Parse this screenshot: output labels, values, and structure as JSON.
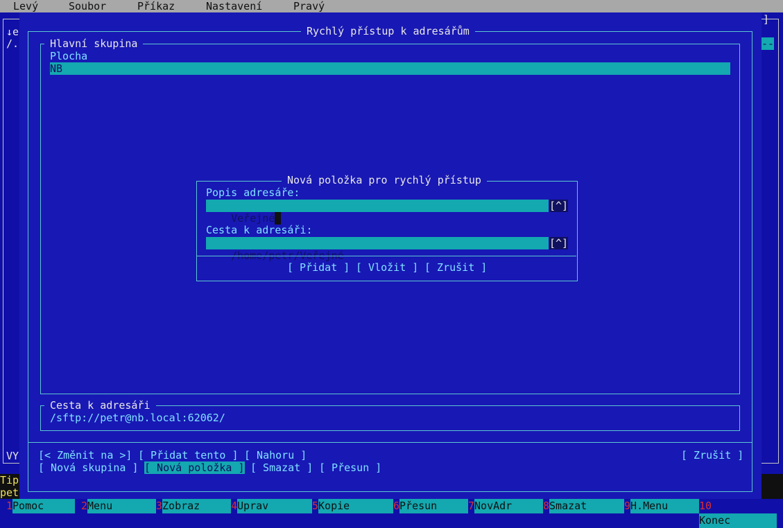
{
  "menubar": {
    "items": [
      "Levý",
      "Soubor",
      "Příkaz",
      "Nastavení",
      "Pravý"
    ]
  },
  "background": {
    "left_line1": "↓e",
    "left_line2": "/.",
    "left_status": "VY",
    "right_corner": "]",
    "right_marker": "--",
    "tip_line": "Tip",
    "pet_line": "pet"
  },
  "dialog": {
    "title": "Rychlý přístup k adresářům",
    "group": {
      "title": "Hlavní skupina",
      "items": [
        "Plocha",
        "NB"
      ],
      "selected_index": 1
    },
    "path_box": {
      "title": "Cesta k adresáři",
      "value": "/sftp://petr@nb.local:62062/"
    },
    "buttons_row1": {
      "change_to": "[< Změnit na >]",
      "add_this": "[ Přidat tento ]",
      "up": "[ Nahoru ]",
      "cancel": "[ Zrušit ]"
    },
    "buttons_row2": {
      "new_group": "[ Nová skupina ]",
      "new_item": "[ Nová položka ]",
      "delete": "[ Smazat ]",
      "move": "[ Přesun ]"
    }
  },
  "subdialog": {
    "title": "Nová položka pro rychlý přístup",
    "description_label": "Popis adresáře:",
    "description_value": "Veřejné",
    "path_label": "Cesta k adresáři:",
    "path_value": "/home/petr/Veřejné",
    "history_button": "[^]",
    "add_button": "[ Přidat ]",
    "insert_button": "[ Vložit ]",
    "cancel_button": "[ Zrušit ]"
  },
  "fkeys": [
    {
      "num": "1",
      "label": "Pomoc"
    },
    {
      "num": "2",
      "label": "Menu"
    },
    {
      "num": "3",
      "label": "Zobraz"
    },
    {
      "num": "4",
      "label": "Uprav"
    },
    {
      "num": "5",
      "label": "Kopie"
    },
    {
      "num": "6",
      "label": "Přesun"
    },
    {
      "num": "7",
      "label": "NovAdr"
    },
    {
      "num": "8",
      "label": "Smazat"
    },
    {
      "num": "9",
      "label": "H.Menu"
    },
    {
      "num": "10",
      "label": "Konec"
    }
  ]
}
